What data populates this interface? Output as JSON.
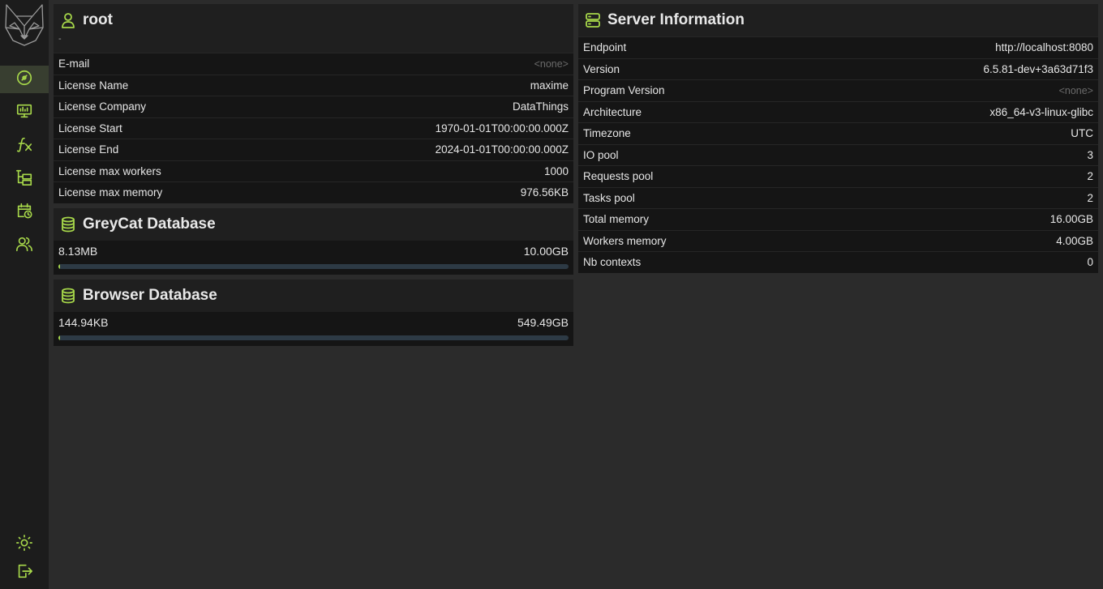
{
  "user_card": {
    "title": "root",
    "subtitle": "-",
    "rows": [
      {
        "label": "E-mail",
        "value": "<none>",
        "none": true
      },
      {
        "label": "License Name",
        "value": "maxime"
      },
      {
        "label": "License Company",
        "value": "DataThings"
      },
      {
        "label": "License Start",
        "value": "1970-01-01T00:00:00.000Z"
      },
      {
        "label": "License End",
        "value": "2024-01-01T00:00:00.000Z"
      },
      {
        "label": "License max workers",
        "value": "1000"
      },
      {
        "label": "License max memory",
        "value": "976.56KB"
      }
    ]
  },
  "greycat_db": {
    "title": "GreyCat Database",
    "used": "8.13MB",
    "total": "10.00GB",
    "usage_fraction": 0.0008
  },
  "browser_db": {
    "title": "Browser Database",
    "used": "144.94KB",
    "total": "549.49GB",
    "usage_fraction": 3e-07
  },
  "server_card": {
    "title": "Server Information",
    "rows": [
      {
        "label": "Endpoint",
        "value": "http://localhost:8080"
      },
      {
        "label": "Version",
        "value": "6.5.81-dev+3a63d71f3"
      },
      {
        "label": "Program Version",
        "value": "<none>",
        "none": true
      },
      {
        "label": "Architecture",
        "value": "x86_64-v3-linux-glibc"
      },
      {
        "label": "Timezone",
        "value": "UTC"
      },
      {
        "label": "IO pool",
        "value": "3"
      },
      {
        "label": "Requests pool",
        "value": "2"
      },
      {
        "label": "Tasks pool",
        "value": "2"
      },
      {
        "label": "Total memory",
        "value": "16.00GB"
      },
      {
        "label": "Workers memory",
        "value": "4.00GB"
      },
      {
        "label": "Nb contexts",
        "value": "0"
      }
    ]
  },
  "sidebar": {
    "items": [
      {
        "icon": "dashboard-icon",
        "active": true
      },
      {
        "icon": "monitor-icon"
      },
      {
        "icon": "function-icon"
      },
      {
        "icon": "tree-icon"
      },
      {
        "icon": "calendar-clock-icon"
      },
      {
        "icon": "users-icon"
      },
      {
        "icon": "sun-icon"
      },
      {
        "icon": "logout-icon"
      }
    ]
  },
  "colors": {
    "accent": "#a7d84a",
    "background": "#2b2b2b",
    "sidebar": "#1c1c1c"
  }
}
